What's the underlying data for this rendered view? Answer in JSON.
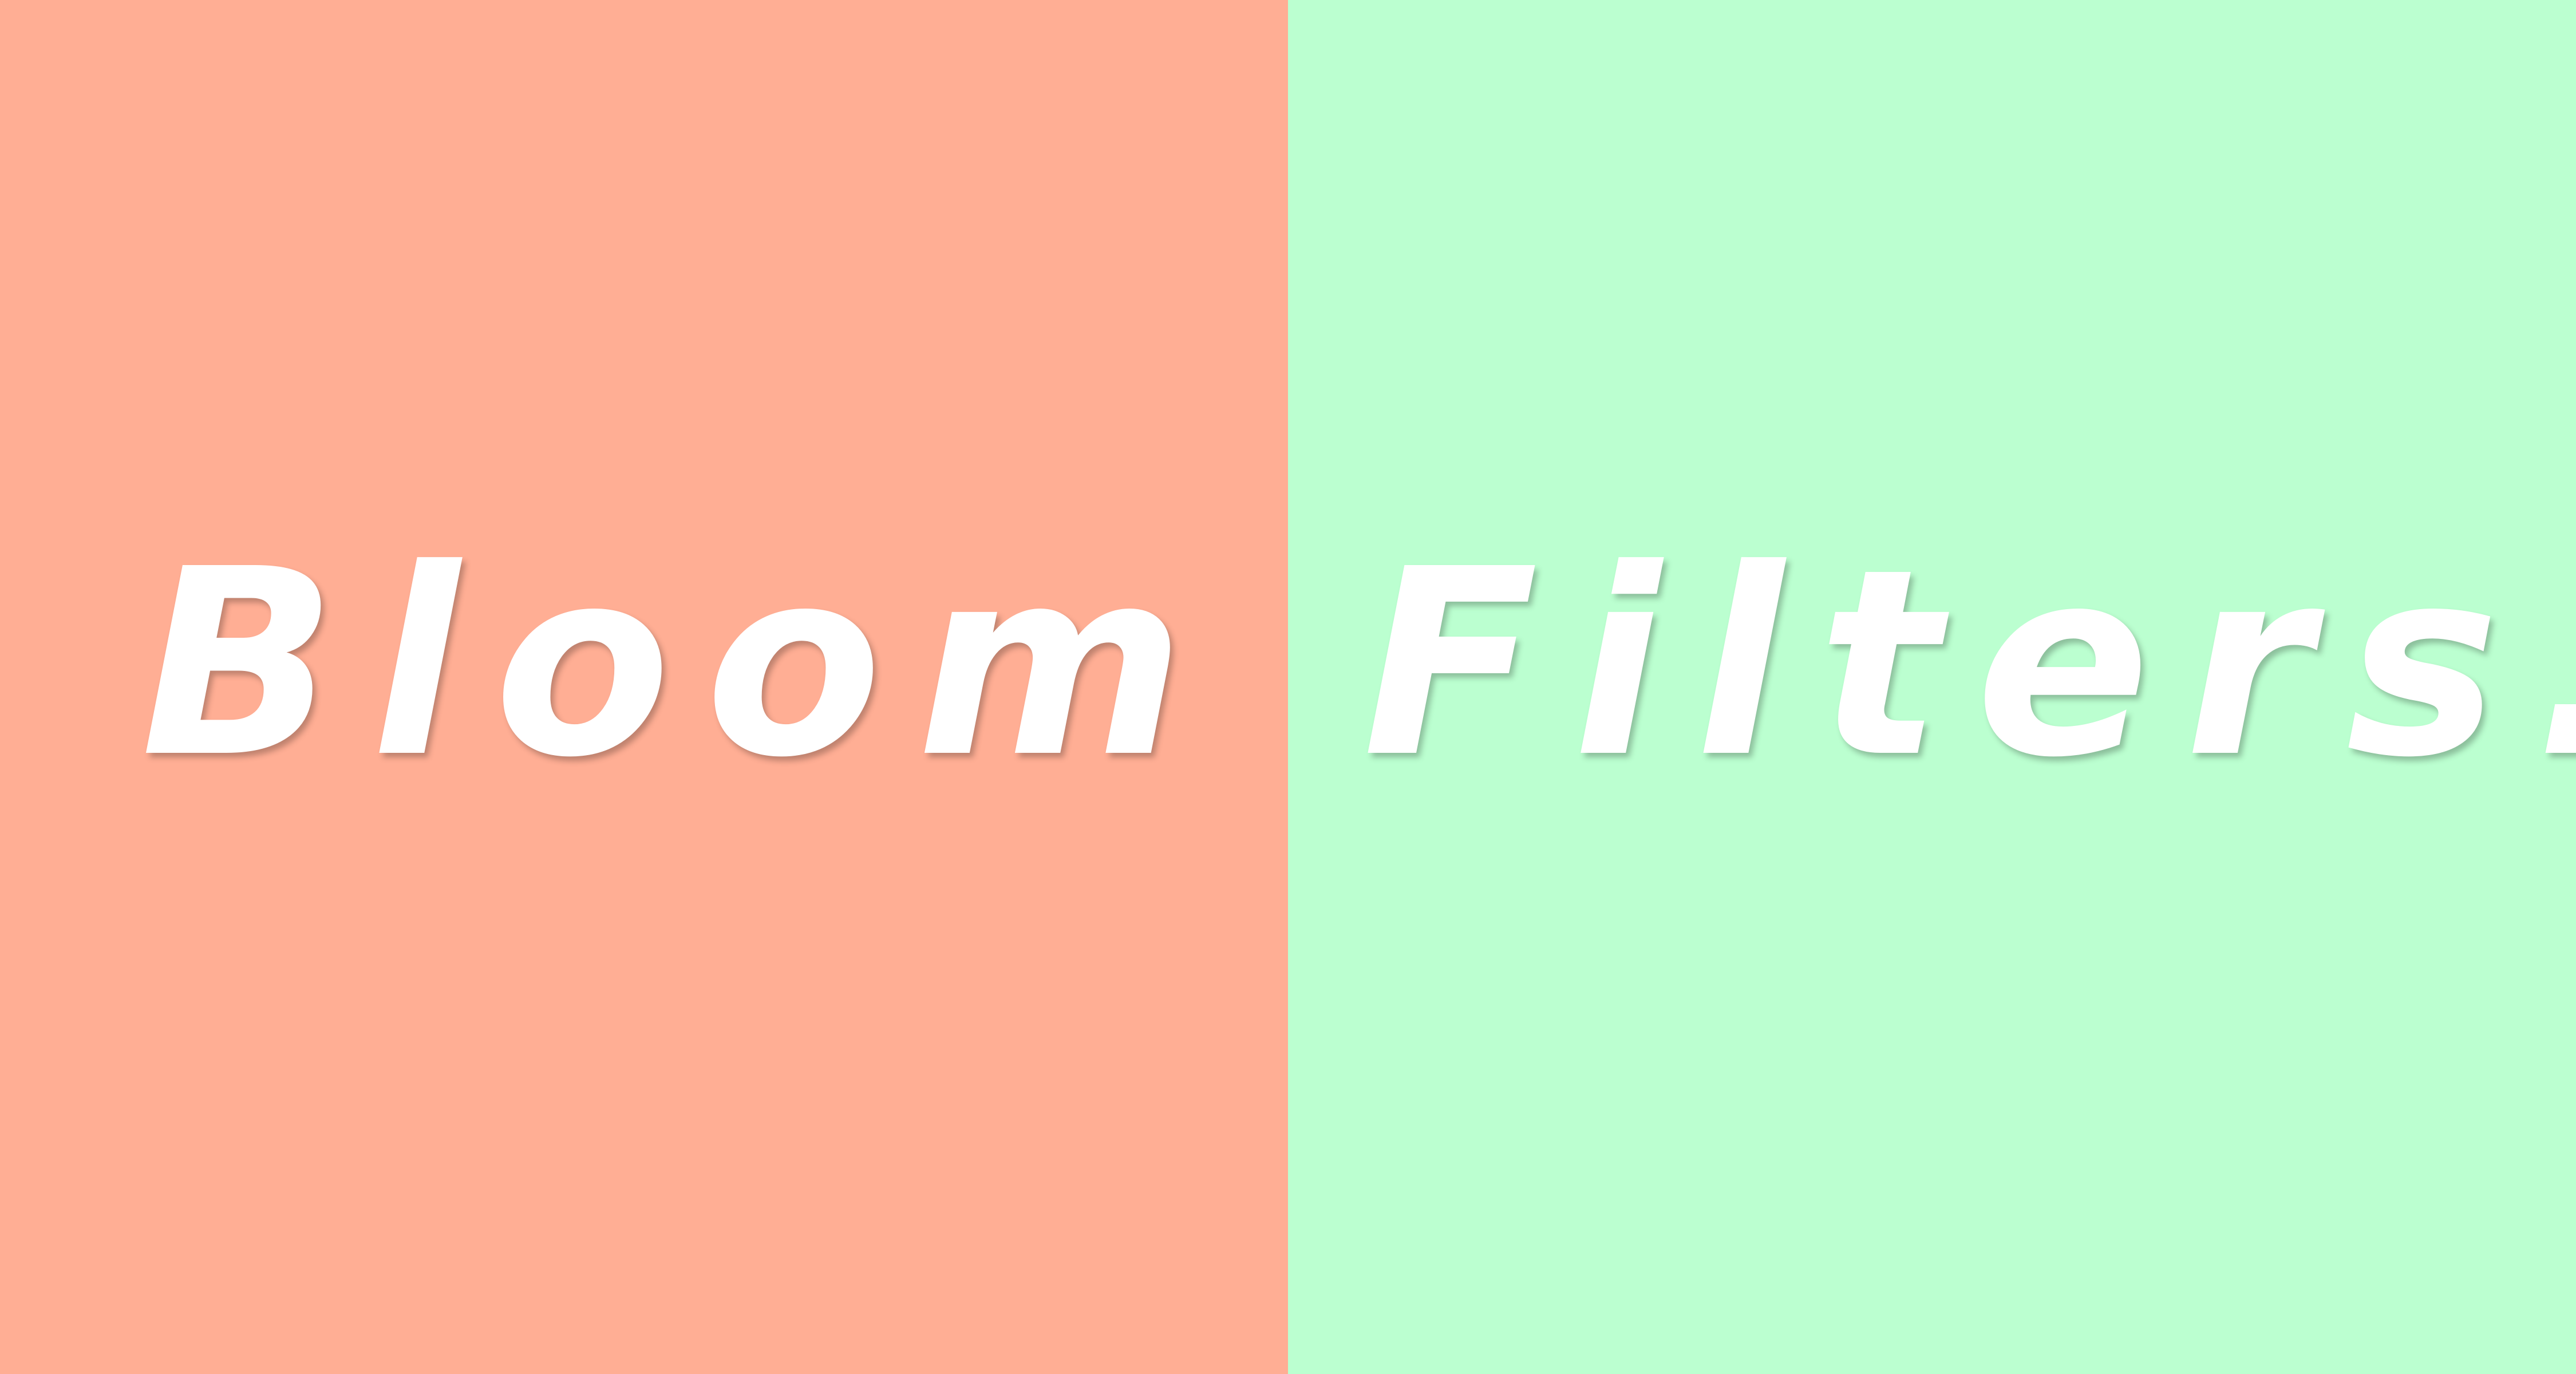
{
  "title": {
    "word_left": "Bloom",
    "word_right": "Filters."
  },
  "colors": {
    "left_background": "#ffae94",
    "right_background": "#bbffd0",
    "text": "#ffffff"
  }
}
